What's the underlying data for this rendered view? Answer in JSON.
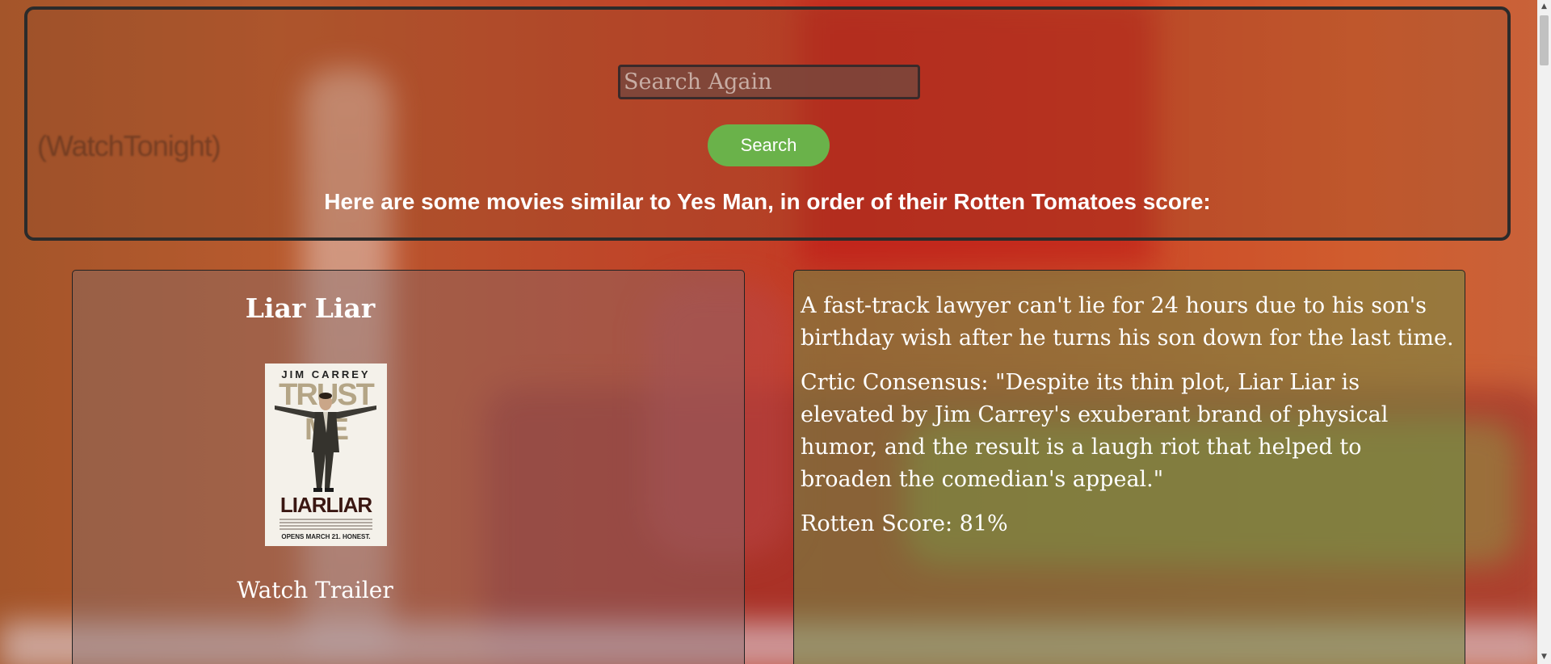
{
  "header": {
    "logo_text": "(WatchTonight)",
    "search_placeholder": "Search Again",
    "search_button_label": "Search",
    "results_heading": "Here are some movies similar to Yes Man, in order of their Rotten Tomatoes score:"
  },
  "movie": {
    "title": "Liar Liar",
    "poster": {
      "top_text": "JIM CARREY",
      "tagline": "TRUST ME",
      "title_text": "LIARLIAR",
      "bottom_text": "OPENS MARCH 21. HONEST."
    },
    "trailer_label": "Watch Trailer",
    "synopsis": "A fast-track lawyer can't lie for 24 hours due to his son's birthday wish after he turns his son down for the last time.",
    "consensus": "Crtic Consensus: \"Despite its thin plot, Liar Liar is elevated by Jim Carrey's exuberant brand of physical humor, and the result is a laugh riot that helped to broaden the comedian's appeal.\"",
    "score": "Rotten Score: 81%"
  },
  "scrollbar": {
    "up_arrow": "▲",
    "down_arrow": "▼"
  },
  "colors": {
    "search_button": "#6ab24a",
    "header_border": "#2b2b2b",
    "text": "#ffffff"
  }
}
